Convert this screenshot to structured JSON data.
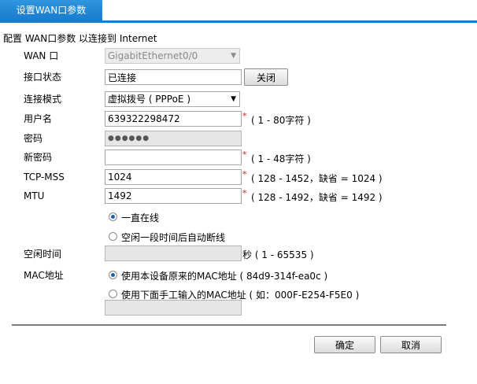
{
  "tab": {
    "label": "设置WAN口参数"
  },
  "heading": "配置 WAN口参数 以连接到 Internet",
  "fields": {
    "wan": {
      "label": "WAN 口",
      "value": "GigabitEthernet0/0"
    },
    "status": {
      "label": "接口状态",
      "value": "已连接",
      "button": "关闭"
    },
    "mode": {
      "label": "连接模式",
      "value": "虚拟拨号 ( PPPoE )"
    },
    "username": {
      "label": "用户名",
      "value": "639322298472",
      "required": "*",
      "hint": "( 1 - 80字符 )"
    },
    "password": {
      "label": "密码",
      "value": "●●●●●●"
    },
    "new_password": {
      "label": "新密码",
      "value": "",
      "required": "*",
      "hint": "( 1 - 48字符 )"
    },
    "tcp_mss": {
      "label": "TCP-MSS",
      "value": "1024",
      "required": "*",
      "hint": "( 128 - 1452，缺省 = 1024 )"
    },
    "mtu": {
      "label": "MTU",
      "value": "1492",
      "required": "*",
      "hint": "( 128 - 1492，缺省 = 1492 )"
    }
  },
  "online_options": {
    "always": "一直在线",
    "idle": "空闲一段时间后自动断线",
    "selected": "always"
  },
  "idle_time": {
    "label": "空闲时间",
    "value": "",
    "unit_hint": "秒 ( 1 - 65535 )"
  },
  "mac": {
    "label": "MAC地址",
    "option_default": "使用本设备原来的MAC地址 ( 84d9-314f-ea0c )",
    "option_manual": "使用下面手工输入的MAC地址 ( 如：000F-E254-F5E0 )",
    "manual_value": "",
    "selected": "default"
  },
  "buttons": {
    "ok": "确定",
    "cancel": "取消"
  },
  "colors": {
    "tab_bg": "#1a7ccd",
    "required": "#e02020",
    "radio_dot": "#1a5fb4"
  }
}
